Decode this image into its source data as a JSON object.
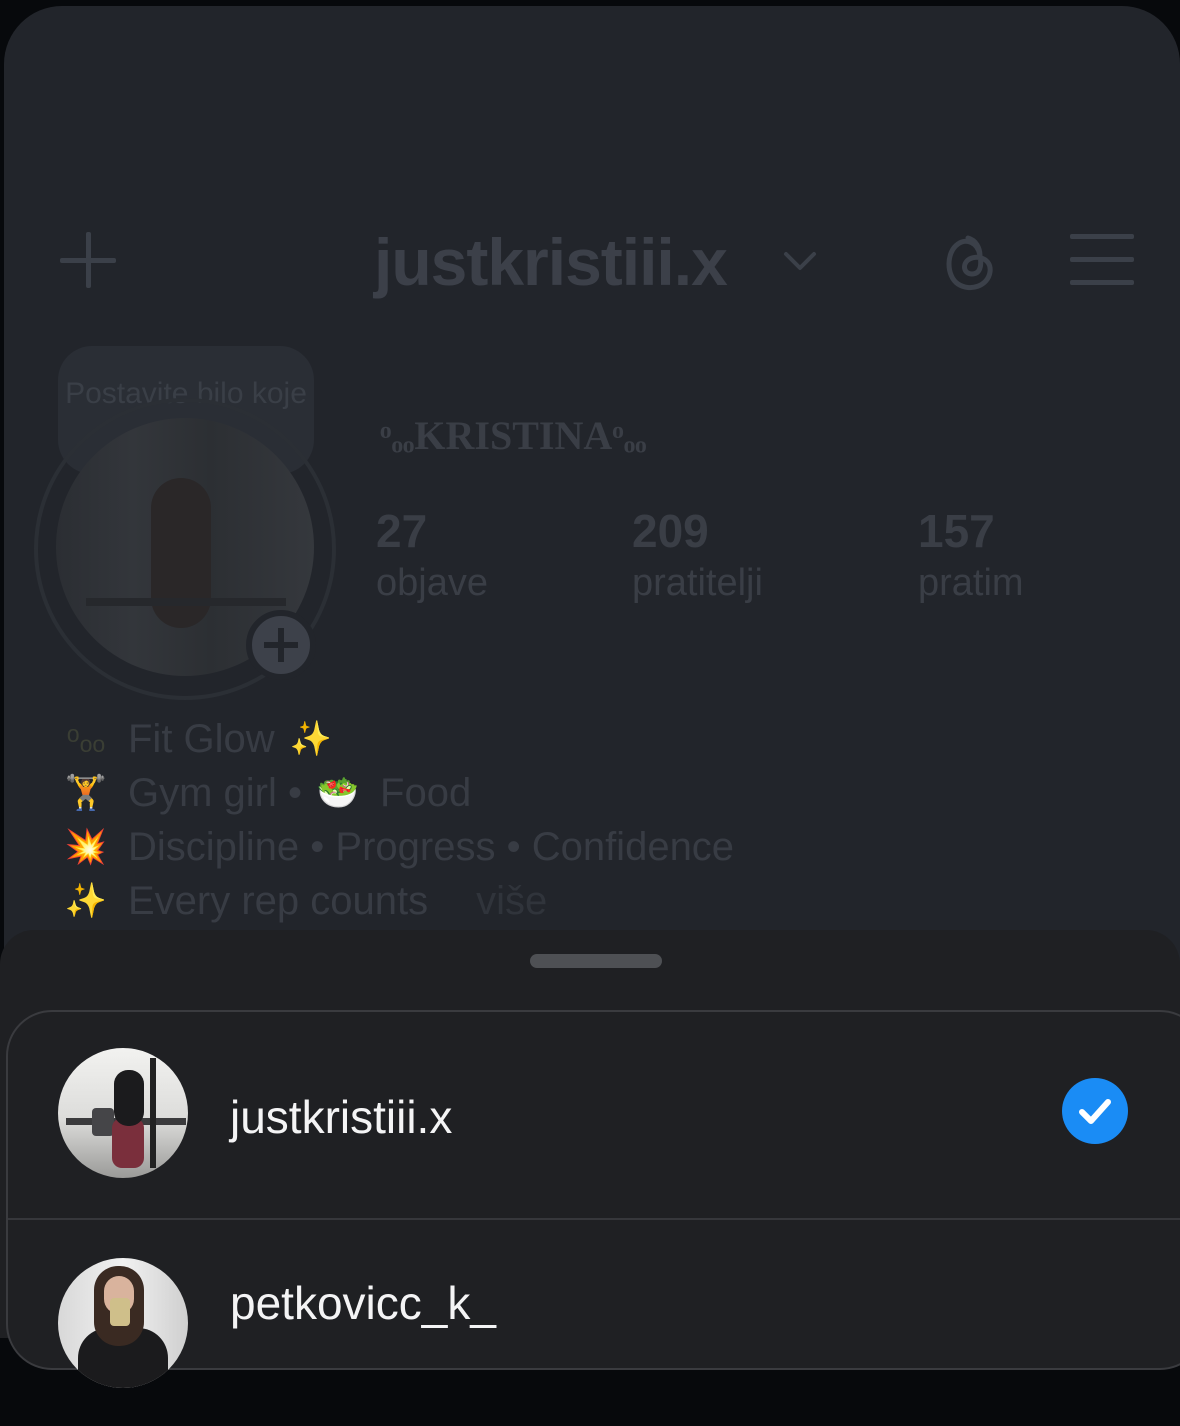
{
  "colors": {
    "accent": "#1a8cf5",
    "sheet_bg": "#1f2023",
    "dim_card_bg": "#22252b"
  },
  "profile": {
    "username": "justkristiii.x",
    "note_text": "Postavite bilo koje pi...",
    "display_name": "ᵒₒₒKRISTINAᵒₒₒ",
    "stats": [
      {
        "value": "27",
        "label": "objave"
      },
      {
        "value": "209",
        "label": "pratitelji"
      },
      {
        "value": "157",
        "label": "pratim"
      }
    ],
    "bio": {
      "line1": {
        "emoji": "ᵒₒₒ",
        "text": "Fit Glow"
      },
      "line1_emoji_end": "✨",
      "line2": {
        "emoji": "🏋",
        "text": "Gym girl • ",
        "emoji2": "🥗",
        "text2": "Food"
      },
      "line3": {
        "emoji": "💥",
        "text": "Discipline • Progress • Confidence"
      },
      "line4": {
        "emoji": "✨",
        "text": "Every rep counts",
        "more": "više"
      }
    },
    "icons": [
      "plus-icon",
      "chevron-down-icon",
      "threads-icon",
      "menu-icon"
    ]
  },
  "sheet": {
    "accounts": [
      {
        "username": "justkristiii.x",
        "selected": true
      },
      {
        "username": "petkovicc_k_",
        "selected": false
      }
    ]
  }
}
